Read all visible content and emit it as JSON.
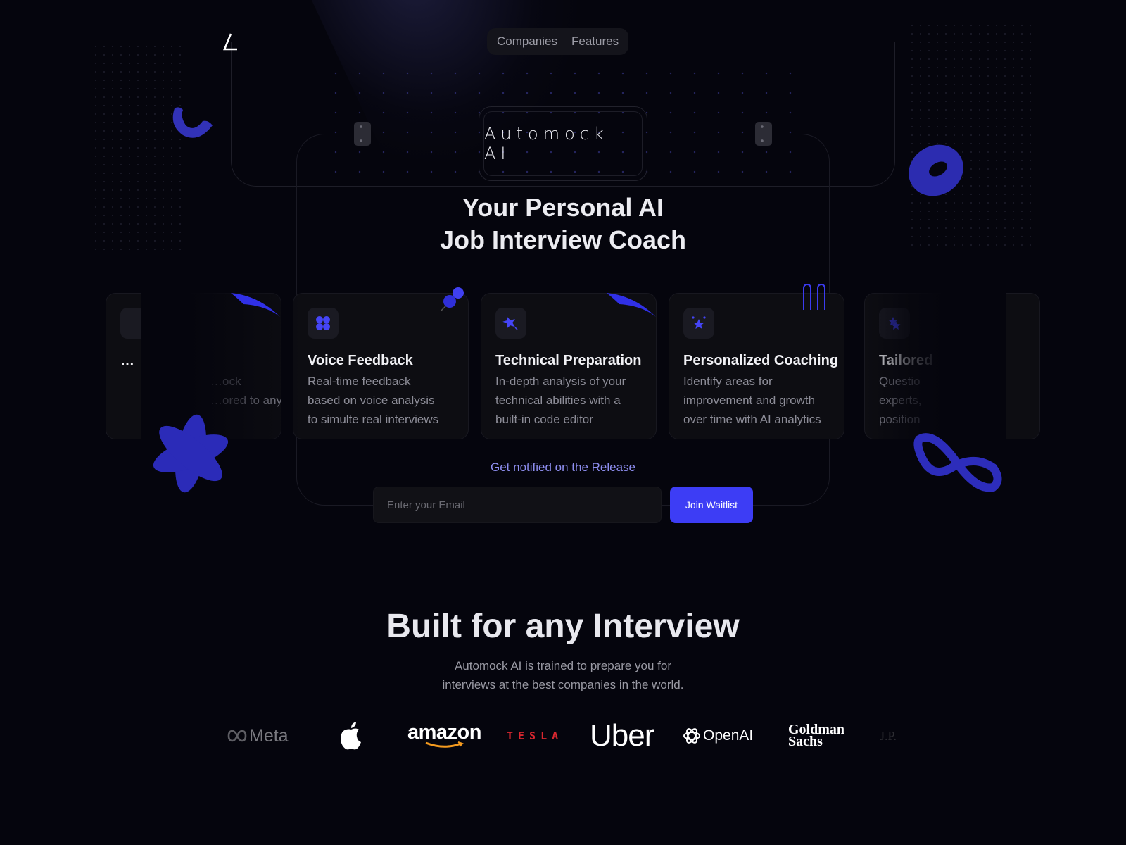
{
  "nav": {
    "logo": "automock-logo",
    "links": [
      "Companies",
      "Features"
    ]
  },
  "brand": {
    "name": "Automock AI"
  },
  "hero": {
    "title_line1": "Your Personal AI",
    "title_line2": "Job Interview Coach"
  },
  "features": [
    {
      "title": "…",
      "lines": [
        "…ock",
        "…ored to any"
      ],
      "icon": "partial-icon",
      "partial": true
    },
    {
      "title": "Voice Feedback",
      "lines": [
        "Real-time feedback",
        "based on voice analysis",
        "to simulte real interviews"
      ],
      "icon": "four-petal-icon"
    },
    {
      "title": "Technical Preparation",
      "lines": [
        "In-depth analysis of your",
        "technical abilities with a",
        "built-in code editor"
      ],
      "icon": "shooting-star-icon"
    },
    {
      "title": "Personalized Coaching",
      "lines": [
        "Identify areas for",
        "improvement and growth",
        "over time with AI analytics"
      ],
      "icon": "sparkle-star-icon"
    },
    {
      "title": "Tailored",
      "lines": [
        "Questio",
        "experts,",
        "position"
      ],
      "icon": "stacked-stars-icon",
      "partial": true
    }
  ],
  "waitlist": {
    "label": "Get notified on the Release",
    "email_placeholder": "Enter your Email",
    "email_value": "",
    "button": "Join Waitlist"
  },
  "companies": {
    "title": "Built for any Interview",
    "subtitle_line1": "Automock AI is trained to prepare you for",
    "subtitle_line2": "interviews at the best companies in the world.",
    "logos": [
      "Meta",
      "Apple",
      "amazon",
      "TESLA",
      "Uber",
      "OpenAI",
      "Goldman Sachs",
      "J.P."
    ]
  },
  "colors": {
    "accent": "#3d3df5",
    "notify": "#8e8ef0",
    "background": "#05050d",
    "tesla": "#d8272f",
    "amazon_arrow": "#f59b1f"
  }
}
